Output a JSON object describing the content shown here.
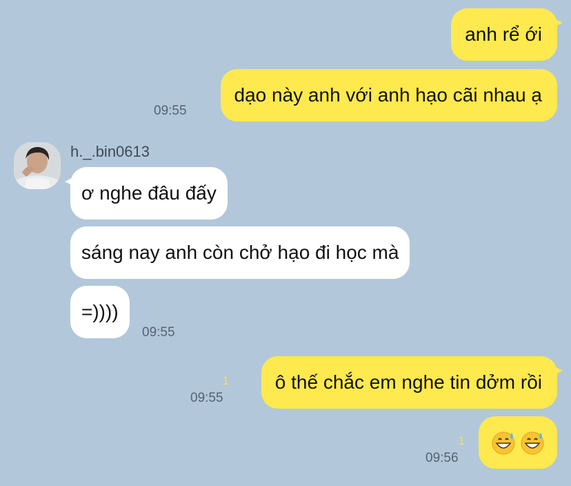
{
  "chat": {
    "contact": {
      "name": "h._.bin0613",
      "avatar_icon": "profile-photo-icon"
    },
    "colors": {
      "background": "#b2c7da",
      "outgoing_bubble": "#fee94e",
      "incoming_bubble": "#ffffff",
      "unread_counter": "#f5e44a"
    },
    "messages": [
      {
        "direction": "outgoing",
        "text": "anh rể ới"
      },
      {
        "direction": "outgoing",
        "text": "dạo này anh với anh hạo cãi nhau ạ",
        "time": "09:55"
      },
      {
        "direction": "incoming",
        "text": "ơ nghe đâu đấy"
      },
      {
        "direction": "incoming",
        "text": "sáng nay anh còn chở hạo đi học mà"
      },
      {
        "direction": "incoming",
        "text": "=))))",
        "time": "09:55"
      },
      {
        "direction": "outgoing",
        "text": "ô thế chắc em nghe tin dởm rồi",
        "time": "09:55",
        "unread": "1"
      },
      {
        "direction": "outgoing",
        "emoji": [
          "grinning-sweat-emoji",
          "grinning-sweat-emoji"
        ],
        "time": "09:56",
        "unread": "1"
      }
    ]
  }
}
